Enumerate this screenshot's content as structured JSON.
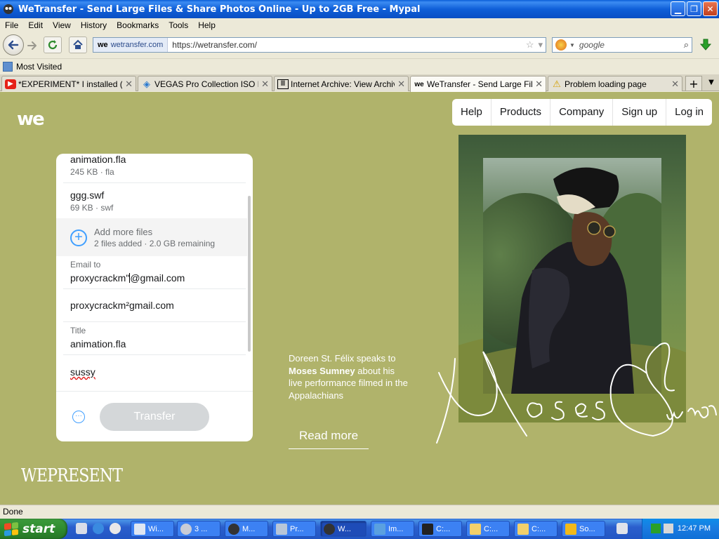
{
  "window": {
    "title": "WeTransfer - Send Large Files & Share Photos Online - Up to 2GB Free - Mypal"
  },
  "menu": [
    "File",
    "Edit",
    "View",
    "History",
    "Bookmarks",
    "Tools",
    "Help"
  ],
  "navbar": {
    "site_identity": "wetransfer.com",
    "url": "https://wetransfer.com/",
    "search_placeholder": "google"
  },
  "bookmarks": {
    "most_visited": "Most Visited"
  },
  "tabs": [
    {
      "label": "*EXPERIMENT* I installed (al...",
      "icon": "youtube-icon",
      "active": false
    },
    {
      "label": "VEGAS Pro Collection ISO Re...",
      "icon": "vegas-icon",
      "active": false
    },
    {
      "label": "Internet Archive: View Archive",
      "icon": "archive-icon",
      "active": false
    },
    {
      "label": "WeTransfer - Send Large File...",
      "icon": "wetransfer-icon",
      "active": true
    },
    {
      "label": "Problem loading page",
      "icon": "warning-icon",
      "active": false
    }
  ],
  "site": {
    "nav": [
      "Help",
      "Products",
      "Company",
      "Sign up",
      "Log in"
    ],
    "files": [
      {
        "name": "animation.fla",
        "meta": "245 KB · fla"
      },
      {
        "name": "ggg.swf",
        "meta": "69 KB · swf"
      }
    ],
    "add_more": {
      "title": "Add more files",
      "subtitle": "2 files added · 2.0 GB remaining"
    },
    "email_to_label": "Email to",
    "email_to_before_cursor": "proxycrackm\"",
    "email_to_after_cursor": "@gmail.com",
    "your_email": "proxycrackm²gmail.com",
    "title_label": "Title",
    "title_value": "animation.fla",
    "message": "sussy",
    "transfer_label": "Transfer",
    "story_intro": "Doreen St. Félix speaks to ",
    "story_name": "Moses Sumney",
    "story_rest": " about his live performance filmed in the Appalachians",
    "read_more": "Read more",
    "wepresent": "WEPRESENT"
  },
  "status": {
    "text": "Done"
  },
  "taskbar": {
    "start": "start",
    "tasks": [
      {
        "label": "Wi...",
        "active": false
      },
      {
        "label": "3 ...",
        "active": false
      },
      {
        "label": "M...",
        "active": false
      },
      {
        "label": "Pr...",
        "active": false
      },
      {
        "label": "W...",
        "active": true
      },
      {
        "label": "Im...",
        "active": false
      },
      {
        "label": "C:...",
        "active": false
      },
      {
        "label": "C:...",
        "active": false
      },
      {
        "label": "C:...",
        "active": false
      },
      {
        "label": "So...",
        "active": false
      }
    ],
    "clock": "12:47 PM"
  },
  "colors": {
    "page_bg": "#b0b36b",
    "accent_blue": "#409fff",
    "xp_title_blue": "#0a5fd8",
    "start_green": "#2f8c2f"
  }
}
